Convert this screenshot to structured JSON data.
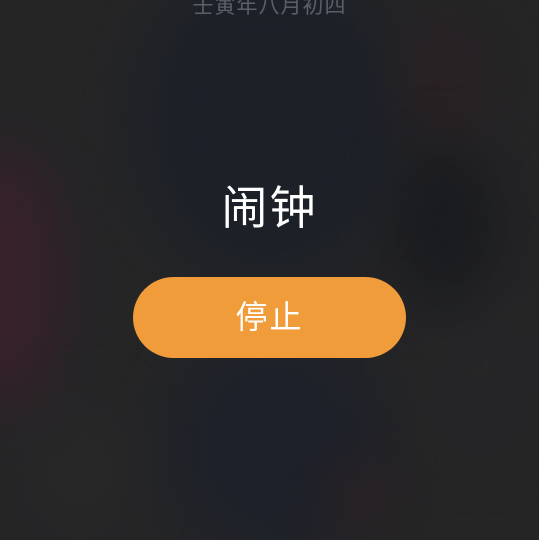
{
  "status": {
    "lunar_date": "壬寅年八月初四"
  },
  "alarm": {
    "title": "闹钟",
    "stop_label": "停止"
  },
  "colors": {
    "accent": "#f19c3a",
    "background": "#2a2a2c",
    "title_text": "#ffffff",
    "lunar_text": "#5b5f6b"
  }
}
